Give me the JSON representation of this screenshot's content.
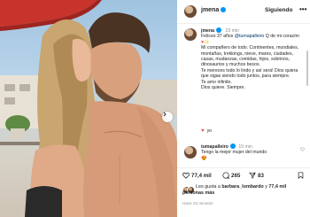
{
  "post": {
    "username": "jmena",
    "follow_label": "Siguiendo",
    "more_label": "•••"
  },
  "caption": {
    "username": "jmena",
    "time": "23 min",
    "line1_pre": "Felices 37 años",
    "mention": "@tumapalleiro",
    "line1_post": "Q de mi corazón",
    "para1": "Mi compañero de todo. Continentes, mundiales, montañas, trekkings, nieve, mares, ciudades, casas, mudanzas, comidas, hijos, sobrinos, dinosaurios y muchos besos.",
    "para2": "Te mereces todo lo lindo y así será! Dios quiera que sigas siendo todo juntos, para siempre.",
    "para3": "Te amo infinito.",
    "para4": "Dios quiere. Siempre.",
    "comment_text": "yo"
  },
  "reply": {
    "username": "tumapalleiro",
    "time": "15 min",
    "text": "Tengo la mejor mujer del mundo"
  },
  "actions": {
    "likes_count": "77,4 mil",
    "comments_count": "265",
    "shares_count": "83"
  },
  "likes": {
    "prefix": "Les gusta a",
    "user": "barbara_lombardo",
    "middle": "y",
    "others": "77,4 mil personas más"
  },
  "timeago": "Hace 23 minutos",
  "colors": {
    "link": "#00376b",
    "heart": "#ed4956",
    "verified": "#0095f6"
  }
}
